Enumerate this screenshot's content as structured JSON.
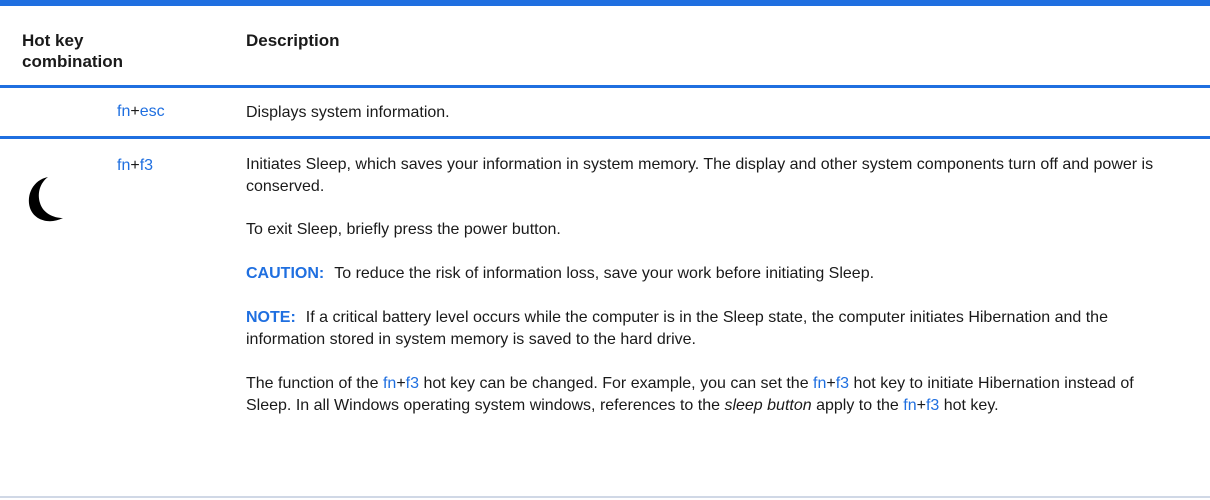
{
  "header": {
    "hotkey": "Hot key\ncombination",
    "description": "Description"
  },
  "rows": [
    {
      "key": [
        "fn",
        "+",
        "esc"
      ],
      "description": "Displays system information."
    },
    {
      "icon": "moon-icon",
      "key": [
        "fn",
        "+",
        "f3"
      ],
      "paragraphs": {
        "p1": "Initiates Sleep, which saves your information in system memory. The display and other system components turn off and power is conserved.",
        "p2": "To exit Sleep, briefly press the power button.",
        "p3_label": "CAUTION:",
        "p3": "To reduce the risk of information loss, save your work before initiating Sleep.",
        "p4_label": "NOTE:",
        "p4": "If a critical battery level occurs while the computer is in the Sleep state, the computer initiates Hibernation and the information stored in system memory is saved to the hard drive.",
        "p5_a": "The function of the ",
        "p5_b": " hot key can be changed. For example, you can set the ",
        "p5_c": " hot key to initiate Hibernation instead of Sleep. In all Windows operating system windows, references to the ",
        "p5_italic": "sleep button",
        "p5_d": " apply to the ",
        "p5_e": " hot key."
      }
    }
  ],
  "colors": {
    "accent": "#1f6fe0",
    "text": "#1a1a1a"
  }
}
